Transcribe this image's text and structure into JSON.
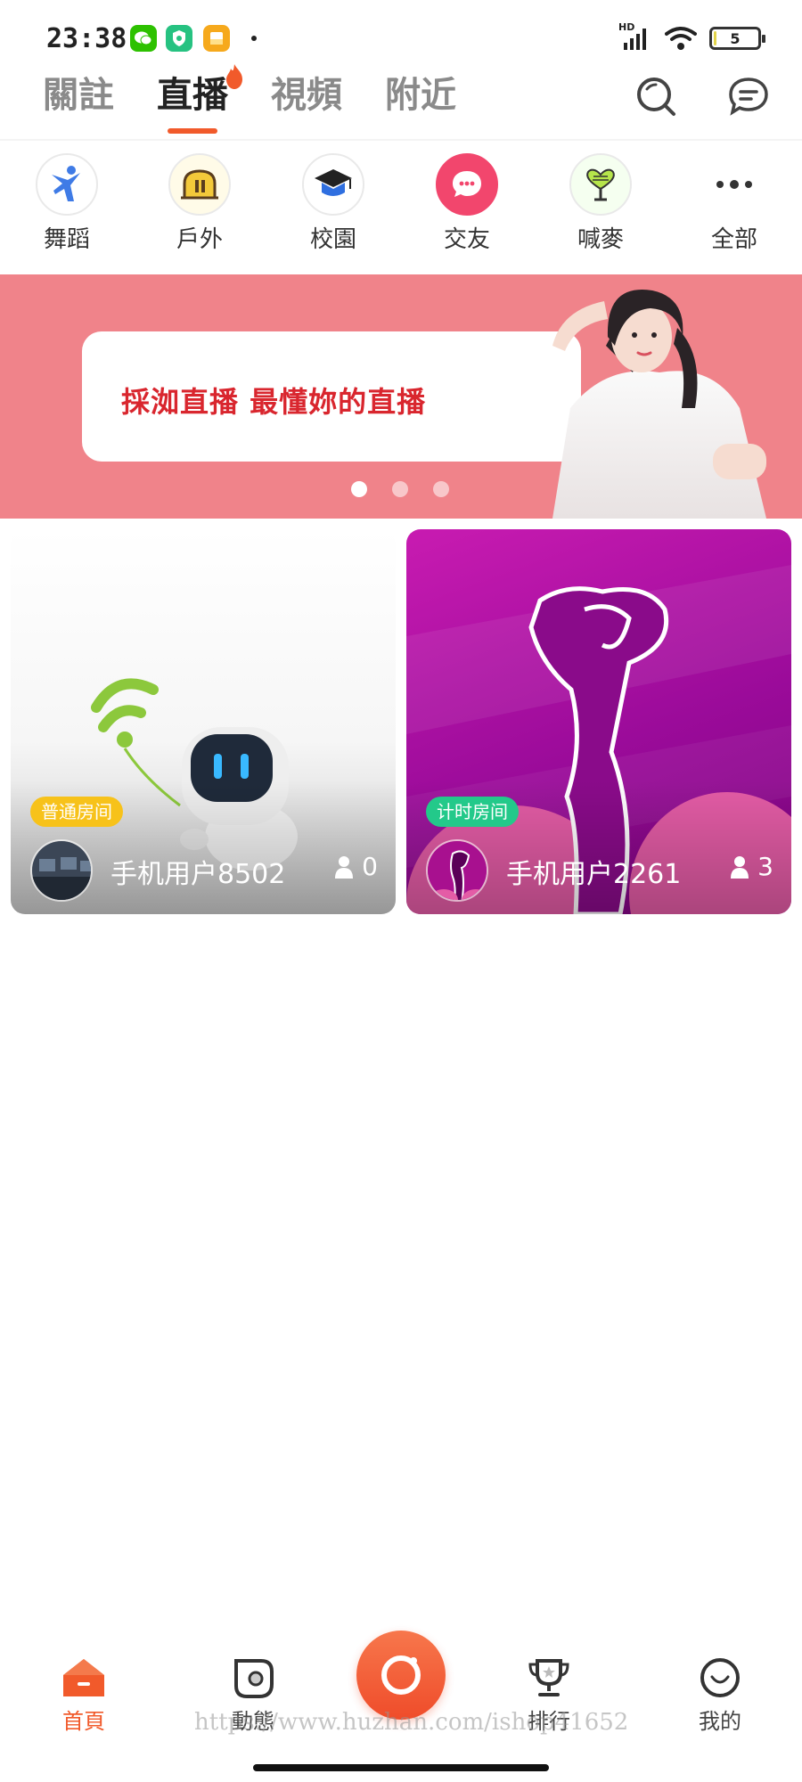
{
  "status_bar": {
    "time": "23:38",
    "network_label": "HD",
    "battery_level": "5",
    "battery_fraction": 0.05,
    "icons": [
      "wechat-icon",
      "shield-app-icon",
      "notes-app-icon",
      "signal-icon",
      "wifi-icon",
      "battery-icon"
    ]
  },
  "header": {
    "tabs": [
      {
        "label": "關註",
        "active": false
      },
      {
        "label": "直播",
        "active": true
      },
      {
        "label": "視頻",
        "active": false
      },
      {
        "label": "附近",
        "active": false
      }
    ],
    "icons": [
      "search-icon",
      "message-icon"
    ],
    "accent_color": "#f15a2b"
  },
  "categories": [
    {
      "label": "舞蹈",
      "icon": "dancer-icon"
    },
    {
      "label": "戶外",
      "icon": "tent-icon"
    },
    {
      "label": "校園",
      "icon": "graduation-cap-icon"
    },
    {
      "label": "交友",
      "icon": "chat-bubble-icon"
    },
    {
      "label": "喊麥",
      "icon": "microphone-icon"
    },
    {
      "label": "全部",
      "icon": "more-dots-icon"
    }
  ],
  "banner": {
    "text": "採洳直播 最懂妳的直播",
    "background_color": "#f0838a",
    "dots": 3,
    "active_dot": 0
  },
  "rooms": [
    {
      "badge": "普通房间",
      "badge_color": "#f7c21a",
      "user": "手机用户8502",
      "viewers": "0"
    },
    {
      "badge": "计时房间",
      "badge_color": "#23c98a",
      "user": "手机用户2261",
      "viewers": "3"
    }
  ],
  "bottom_nav": {
    "items": [
      {
        "label": "首頁",
        "icon": "home-icon",
        "active": true
      },
      {
        "label": "動態",
        "icon": "moments-icon",
        "active": false
      },
      {
        "label": "",
        "icon": "live-camera-icon",
        "active": false
      },
      {
        "label": "排行",
        "icon": "trophy-icon",
        "active": false
      },
      {
        "label": "我的",
        "icon": "profile-icon",
        "active": false
      }
    ]
  },
  "watermark": "https://www.huzhan.com/ishop41652"
}
